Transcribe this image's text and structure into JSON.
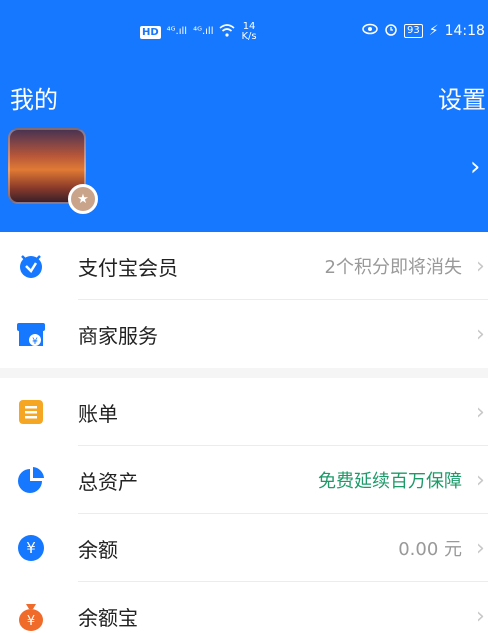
{
  "status_bar": {
    "hd": "HD",
    "signal1": "⁴ᴳ.ıll",
    "signal2": "⁴ᴳ.ıll",
    "speed_value": "14",
    "speed_unit": "K/s",
    "battery": "93",
    "time": "14:18"
  },
  "header": {
    "title": "我的",
    "settings_label": "设置"
  },
  "section1": [
    {
      "label": "支付宝会员",
      "value": "2个积分即将消失",
      "icon": "member-icon",
      "color": "#1677ff"
    },
    {
      "label": "商家服务",
      "value": "",
      "icon": "merchant-icon",
      "color": "#1677ff"
    }
  ],
  "section2": [
    {
      "label": "账单",
      "value": "",
      "icon": "bill-icon",
      "color": "#f5a623"
    },
    {
      "label": "总资产",
      "value": "免费延续百万保障",
      "icon": "pie-chart-icon",
      "color": "#1677ff"
    },
    {
      "label": "余额",
      "value": "0.00 元",
      "icon": "balance-icon",
      "color": "#1677ff"
    },
    {
      "label": "余额宝",
      "value": "",
      "icon": "yuebao-icon",
      "color": "#f06a2a"
    }
  ]
}
